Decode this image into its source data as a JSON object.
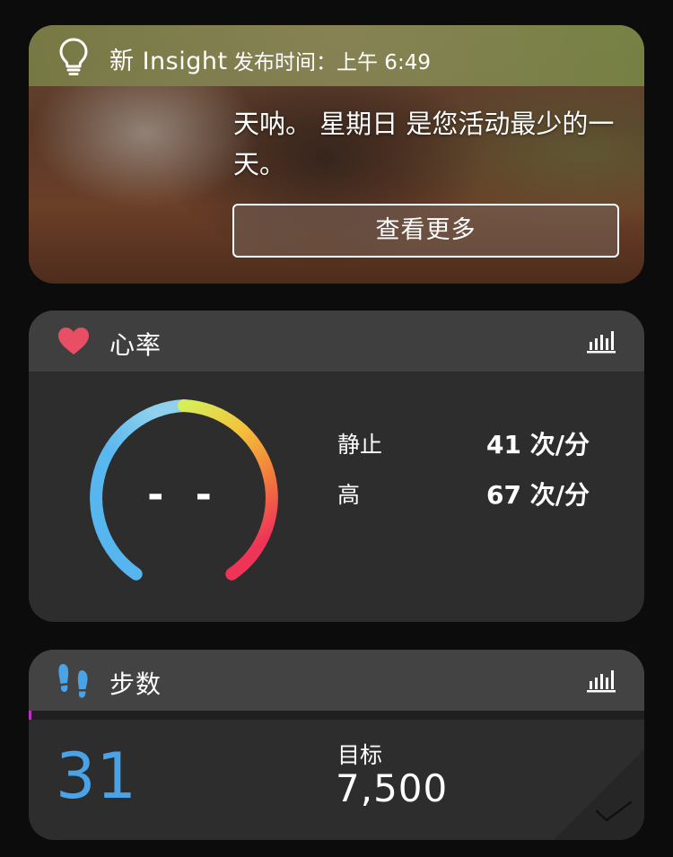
{
  "insight": {
    "title": "新 Insight",
    "time": "发布时间：上午 6:49",
    "message": "天呐。 星期日 是您活动最少的一天。",
    "button_label": "查看更多"
  },
  "heart_rate": {
    "title": "心率",
    "current_value": "- -",
    "rows": [
      {
        "label": "静止",
        "value": "41 次/分"
      },
      {
        "label": "高",
        "value": "67 次/分"
      }
    ],
    "colors": {
      "heart": "#e94f64",
      "gauge_start": "#54b4ee",
      "gauge_mid": "#d6ee5a",
      "gauge_end": "#ee3558"
    }
  },
  "steps": {
    "title": "步数",
    "count": "31",
    "goal_label": "目标",
    "goal_value": "7,500",
    "progress_fraction": 0.004,
    "colors": {
      "count": "#4aa3e6",
      "progress": "#c030c8",
      "icon": "#4aa3e6"
    }
  }
}
